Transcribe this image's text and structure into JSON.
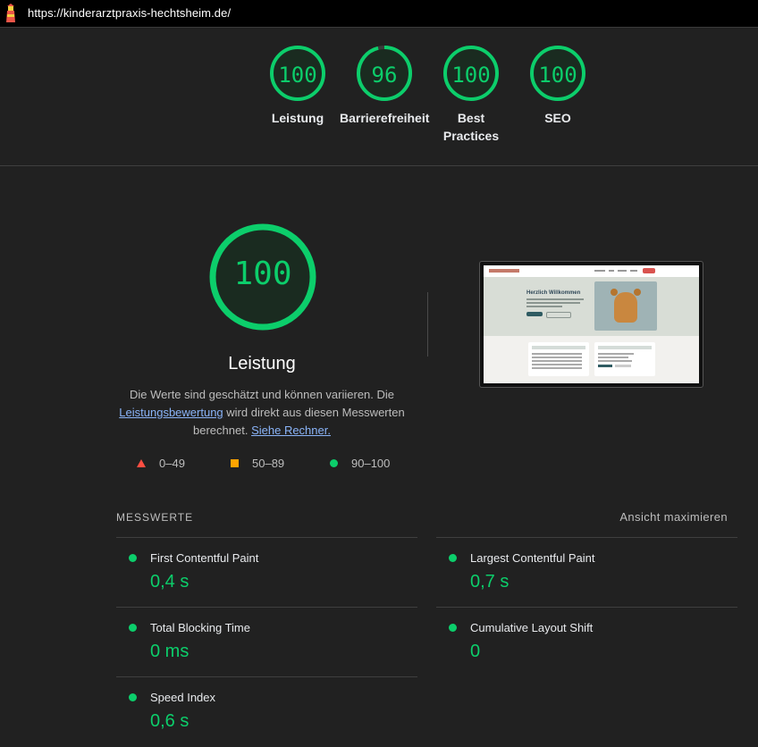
{
  "browser": {
    "url": "https://kinderarztpraxis-hechtsheim.de/"
  },
  "categories": [
    {
      "score": "100",
      "label": "Leistung"
    },
    {
      "score": "96",
      "label": "Barrierefreiheit"
    },
    {
      "score": "100",
      "label": "Best Practices"
    },
    {
      "score": "100",
      "label": "SEO"
    }
  ],
  "performance": {
    "score": "100",
    "title": "Leistung",
    "desc_part1": "Die Werte sind geschätzt und können variieren. Die",
    "desc_link1": "Leistungsbewertung",
    "desc_part2": "wird direkt aus diesen Messwerten berechnet.",
    "desc_link2": "Siehe Rechner."
  },
  "screenshot": {
    "heading": "Herzlich Willkommen"
  },
  "legend": {
    "fail": "0–49",
    "average": "50–89",
    "pass": "90–100"
  },
  "metrics": {
    "header": "MESSWERTE",
    "toggle": "Ansicht maximieren",
    "items": [
      {
        "name": "First Contentful Paint",
        "value": "0,4 s"
      },
      {
        "name": "Largest Contentful Paint",
        "value": "0,7 s"
      },
      {
        "name": "Total Blocking Time",
        "value": "0 ms"
      },
      {
        "name": "Cumulative Layout Shift",
        "value": "0"
      },
      {
        "name": "Speed Index",
        "value": "0,6 s"
      }
    ]
  },
  "colors": {
    "pass": "#0cce6b",
    "average": "#ffa400",
    "fail": "#ff4e42",
    "background": "#212121",
    "link": "#8ab4f8"
  }
}
